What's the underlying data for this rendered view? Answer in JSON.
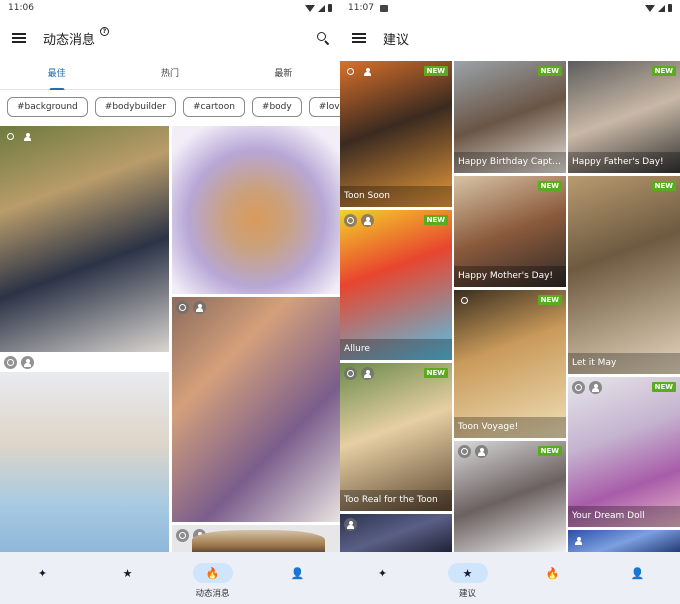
{
  "left_screen": {
    "status": {
      "time": "11:06"
    },
    "app_bar": {
      "title": "动态消息",
      "help_icon": "?"
    },
    "tabs": [
      {
        "label": "最佳",
        "active": true
      },
      {
        "label": "热门",
        "active": false
      },
      {
        "label": "最新",
        "active": false
      }
    ],
    "chips": [
      "#background",
      "#bodybuilder",
      "#cartoon",
      "#body",
      "#love"
    ],
    "nav": [
      {
        "icon": "magic-wand-icon",
        "glyph": "✦",
        "label": "",
        "active": false
      },
      {
        "icon": "star-icon",
        "glyph": "★",
        "label": "",
        "active": false
      },
      {
        "icon": "fire-icon",
        "glyph": "🔥",
        "label": "动态消息",
        "active": true
      },
      {
        "icon": "profile-icon",
        "glyph": "👤",
        "label": "",
        "active": false
      }
    ]
  },
  "right_screen": {
    "status": {
      "time": "11:07"
    },
    "app_bar": {
      "title": "建议"
    },
    "tiles": [
      {
        "caption": "Toon Soon",
        "badge": "NEW"
      },
      {
        "caption": "Happy Birthday Captio...",
        "badge": "NEW"
      },
      {
        "caption": "Happy Father's Day!",
        "badge": "NEW"
      },
      {
        "caption": "Allure",
        "badge": "NEW"
      },
      {
        "caption": "Happy Mother's Day!",
        "badge": "NEW"
      },
      {
        "caption": "Let it May",
        "badge": "NEW"
      },
      {
        "caption": "Toon Voyage!",
        "badge": "NEW"
      },
      {
        "caption": "Too Real for the Toon",
        "badge": "NEW"
      },
      {
        "caption": "Your Dream Doll",
        "badge": "NEW"
      },
      {
        "caption": "",
        "badge": "NEW"
      }
    ],
    "nav": [
      {
        "icon": "magic-wand-icon",
        "glyph": "✦",
        "label": "",
        "active": false
      },
      {
        "icon": "star-icon",
        "glyph": "★",
        "label": "建议",
        "active": true
      },
      {
        "icon": "fire-icon",
        "glyph": "🔥",
        "label": "",
        "active": false
      },
      {
        "icon": "profile-icon",
        "glyph": "👤",
        "label": "",
        "active": false
      }
    ]
  }
}
